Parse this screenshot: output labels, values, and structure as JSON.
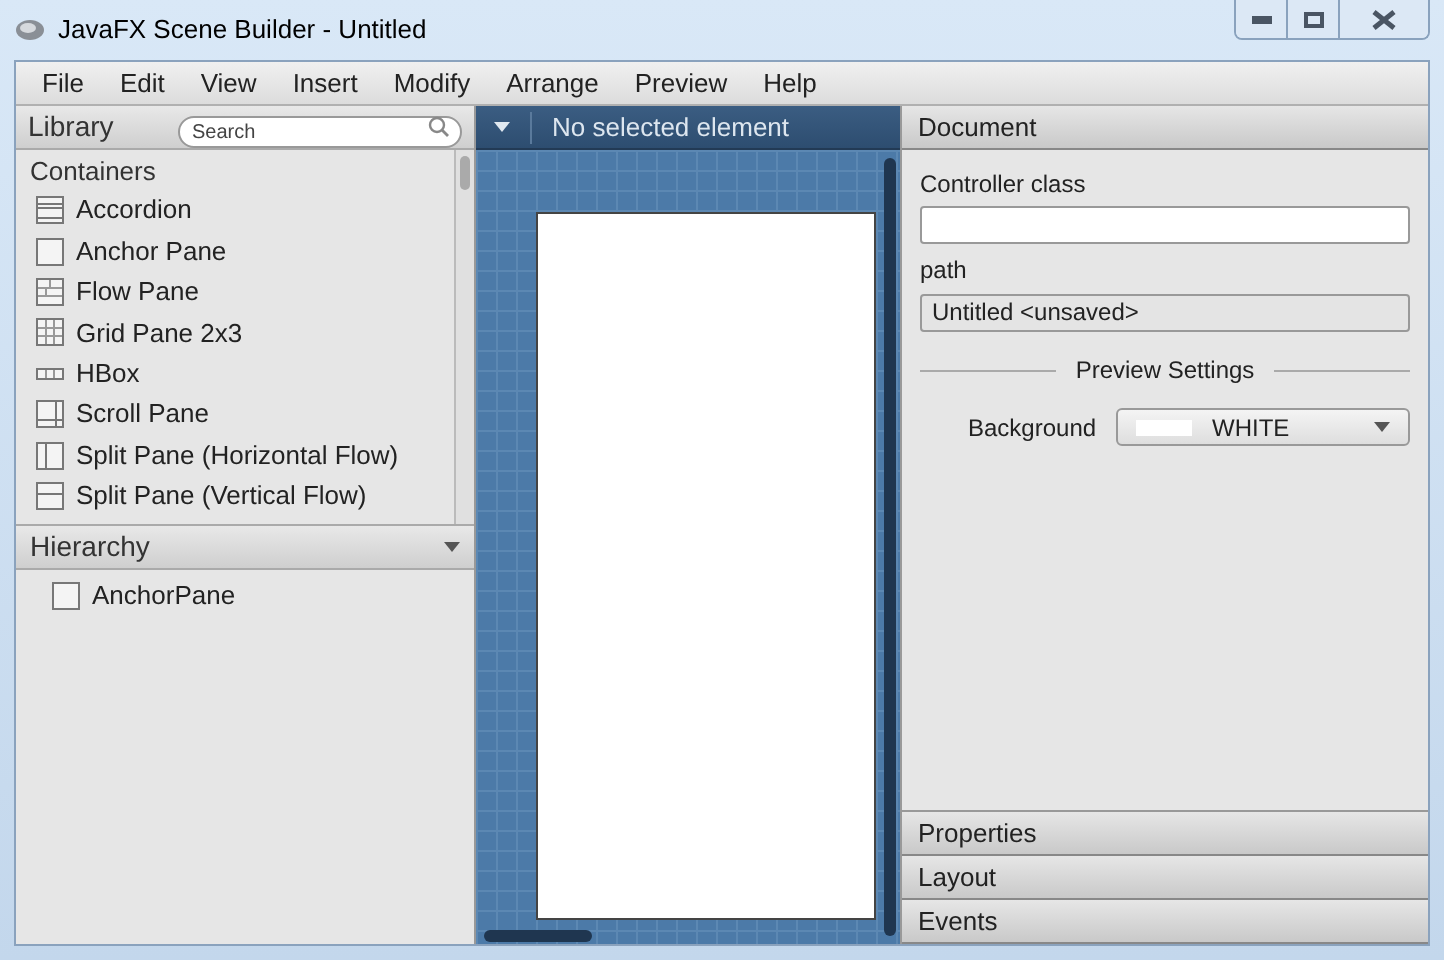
{
  "window": {
    "title": "JavaFX Scene Builder - Untitled"
  },
  "menu": [
    "File",
    "Edit",
    "View",
    "Insert",
    "Modify",
    "Arrange",
    "Preview",
    "Help"
  ],
  "library": {
    "title": "Library",
    "search": {
      "placeholder": "Search"
    },
    "category": "Containers",
    "items": [
      {
        "label": "Accordion",
        "kind": "accordion"
      },
      {
        "label": "Anchor Pane",
        "kind": "anchor"
      },
      {
        "label": "Flow Pane",
        "kind": "flow"
      },
      {
        "label": "Grid Pane 2x3",
        "kind": "grid"
      },
      {
        "label": "HBox",
        "kind": "hbox"
      },
      {
        "label": "Scroll Pane",
        "kind": "scroll"
      },
      {
        "label": "Split Pane (Horizontal Flow)",
        "kind": "splith"
      },
      {
        "label": "Split Pane (Vertical Flow)",
        "kind": "splitv"
      }
    ]
  },
  "hierarchy": {
    "title": "Hierarchy",
    "items": [
      {
        "label": "AnchorPane"
      }
    ]
  },
  "content": {
    "status": "No selected element"
  },
  "inspector": {
    "title": "Document",
    "collapsed_sections": [
      "Properties",
      "Layout",
      "Events"
    ],
    "controller_label": "Controller class",
    "path_label": "path",
    "path_value": "Untitled <unsaved>",
    "preview_settings": "Preview Settings",
    "background_label": "Background",
    "background_value": "WHITE"
  }
}
